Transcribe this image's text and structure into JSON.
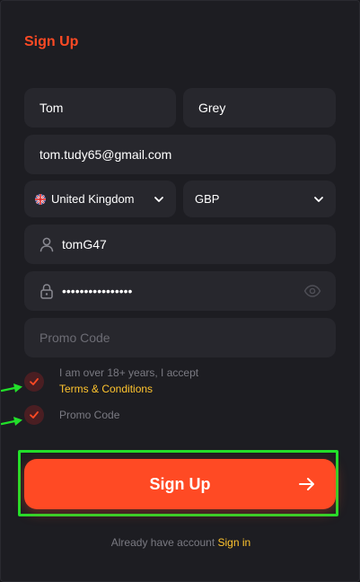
{
  "form": {
    "title": "Sign Up",
    "first_name": "Tom",
    "last_name": "Grey",
    "email": "tom.tudy65@gmail.com",
    "country": "United Kingdom",
    "currency": "GBP",
    "username": "tomG47",
    "password_masked": "••••••••••••••••",
    "promo_placeholder": "Promo Code",
    "age_check_text": "I am over 18+ years, I accept",
    "terms_link": "Terms & Conditions",
    "promo_check_text": "Promo Code",
    "submit_label": "Sign Up",
    "footer_text": "Already have account ",
    "signin_link": "Sign in"
  },
  "colors": {
    "accent": "#ff4a24",
    "link": "#ffc42e",
    "highlight": "#22e02a"
  },
  "icons": [
    "uk-flag-icon",
    "chevron-down-icon",
    "user-icon",
    "lock-icon",
    "eye-icon",
    "checkmark-icon",
    "arrow-right-icon",
    "annotation-arrow-icon"
  ]
}
